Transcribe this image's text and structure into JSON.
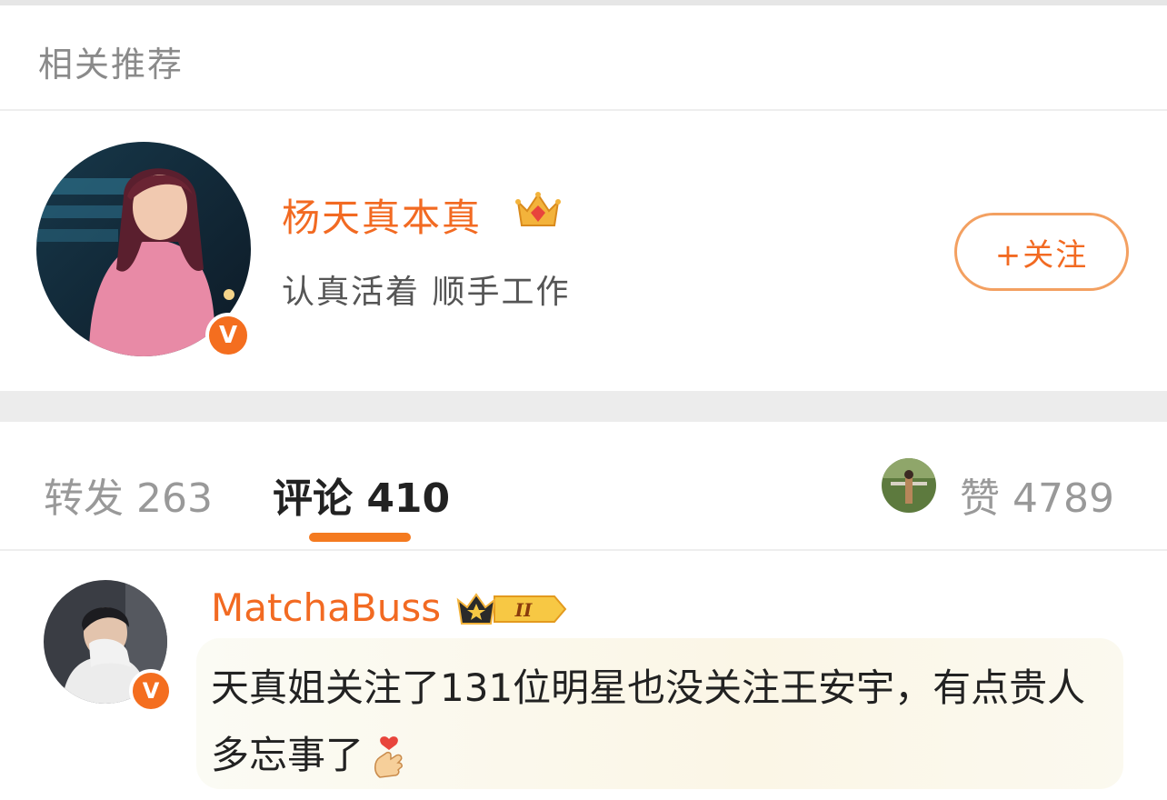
{
  "section": {
    "title": "相关推荐"
  },
  "recommended_user": {
    "name": "杨天真本真",
    "bio": "认真活着 顺手工作",
    "verified_badge": "V",
    "follow_label": "+关注",
    "name_color": "#f26a22"
  },
  "tabs": {
    "repost": "转发 263",
    "comment": "评论 410",
    "like": "赞 4789",
    "active": "comment",
    "indicator_color": "#f47a20"
  },
  "comment": {
    "author": "MatchaBuss",
    "verified_badge": "V",
    "vip_level": "II",
    "text": "天真姐关注了131位明星也没关注王安宇，有点贵人多忘事了",
    "emoji": "finger-heart-icon"
  },
  "colors": {
    "accent": "#f26a22",
    "divider": "#eeeeee",
    "band": "#ececec"
  }
}
